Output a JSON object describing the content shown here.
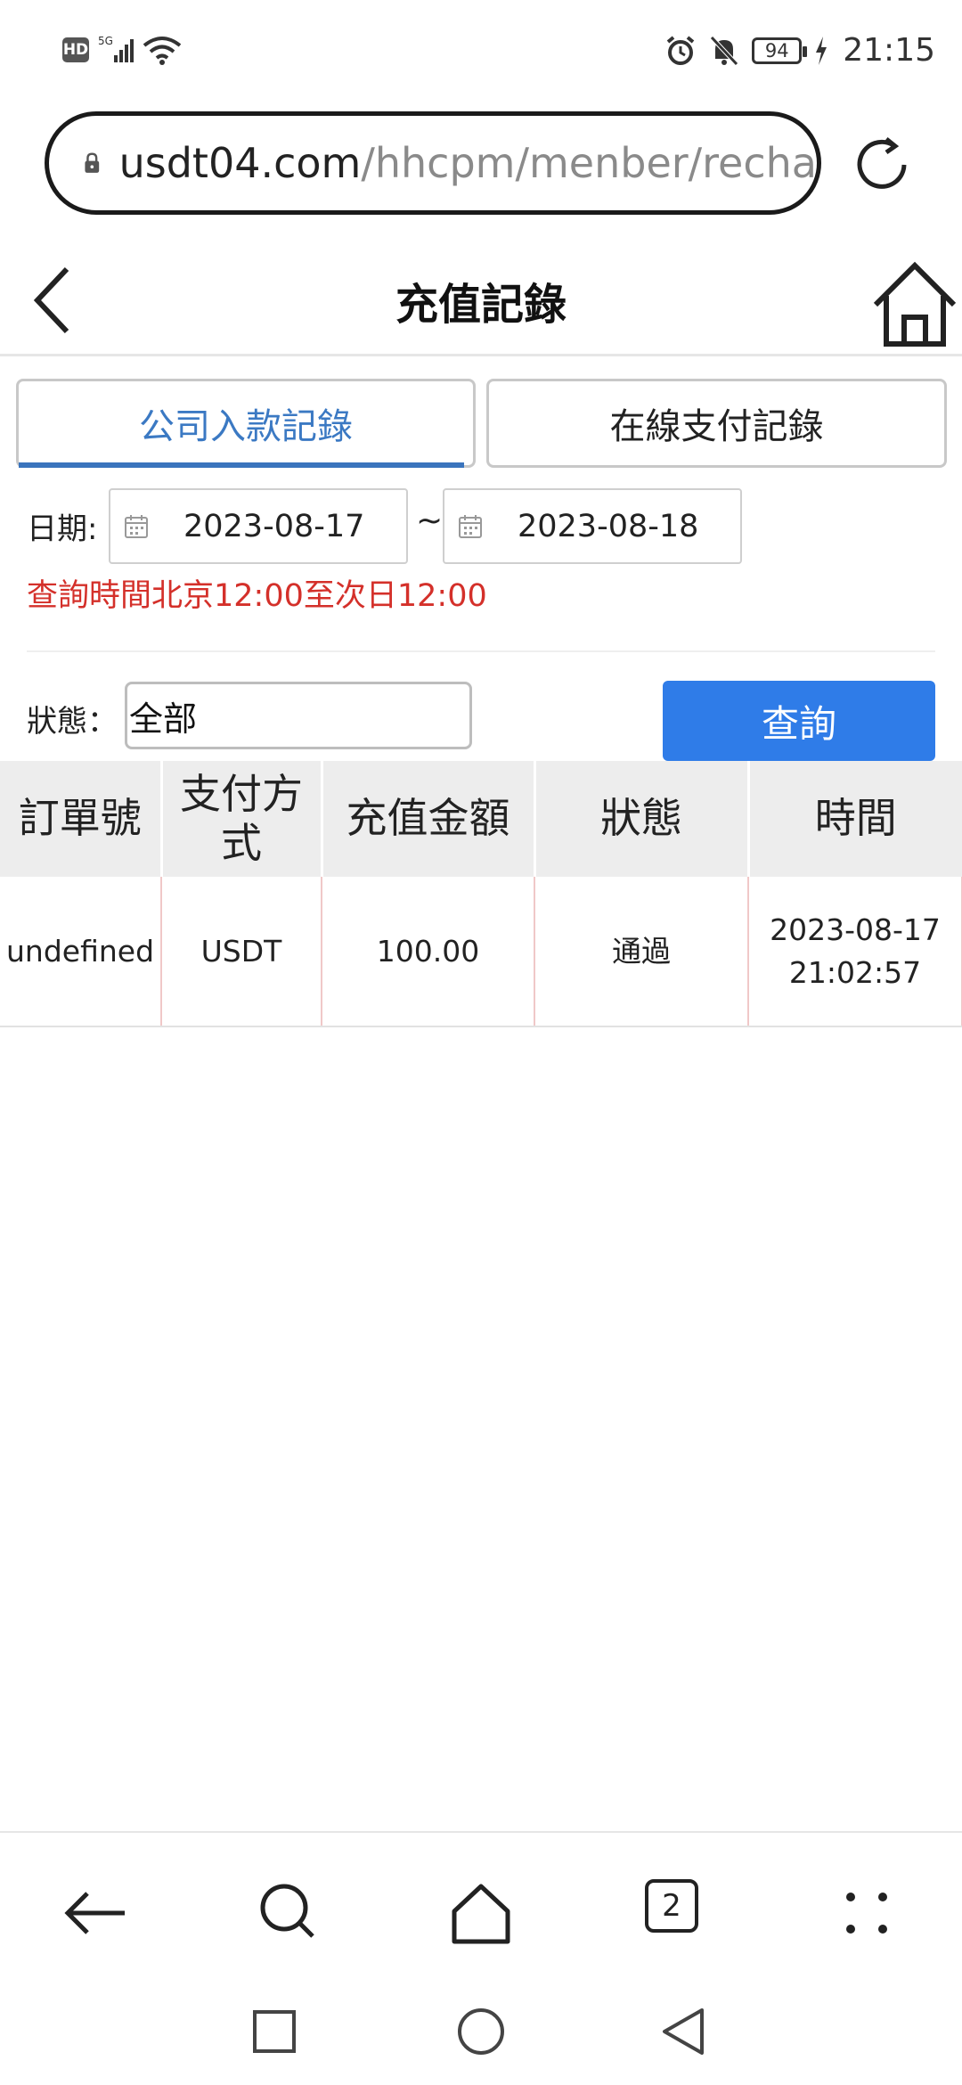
{
  "status_bar": {
    "hd": "HD",
    "network": "5G",
    "battery": "94",
    "time": "21:15"
  },
  "browser": {
    "url_host": "usdt04.com",
    "url_path": "/hhcpm/menber/recha"
  },
  "header": {
    "title": "充值記錄"
  },
  "tabs": [
    {
      "label": "公司入款記錄",
      "active": true
    },
    {
      "label": "在線支付記錄",
      "active": false
    }
  ],
  "filters": {
    "date_label": "日期:",
    "date_from": "2023-08-17",
    "separator": "~",
    "date_to": "2023-08-18",
    "query_note": "查詢時間北京12:00至次日12:00",
    "status_label": "狀態：",
    "status_value": "全部",
    "query_button": "查詢"
  },
  "table": {
    "headers": [
      "訂單號",
      "支付方式",
      "充值金額",
      "狀態",
      "時間"
    ],
    "rows": [
      {
        "order_no": "undefined",
        "method": "USDT",
        "amount": "100.00",
        "status": "通過",
        "time_date": "2023-08-17",
        "time_clock": "21:02:57"
      }
    ]
  },
  "bottom_nav": {
    "tab_count": "2"
  },
  "colors": {
    "accent_blue": "#2f7ce8",
    "tab_active_text": "#3b79c3",
    "note_red": "#d4302a",
    "header_bg": "#ededed"
  }
}
